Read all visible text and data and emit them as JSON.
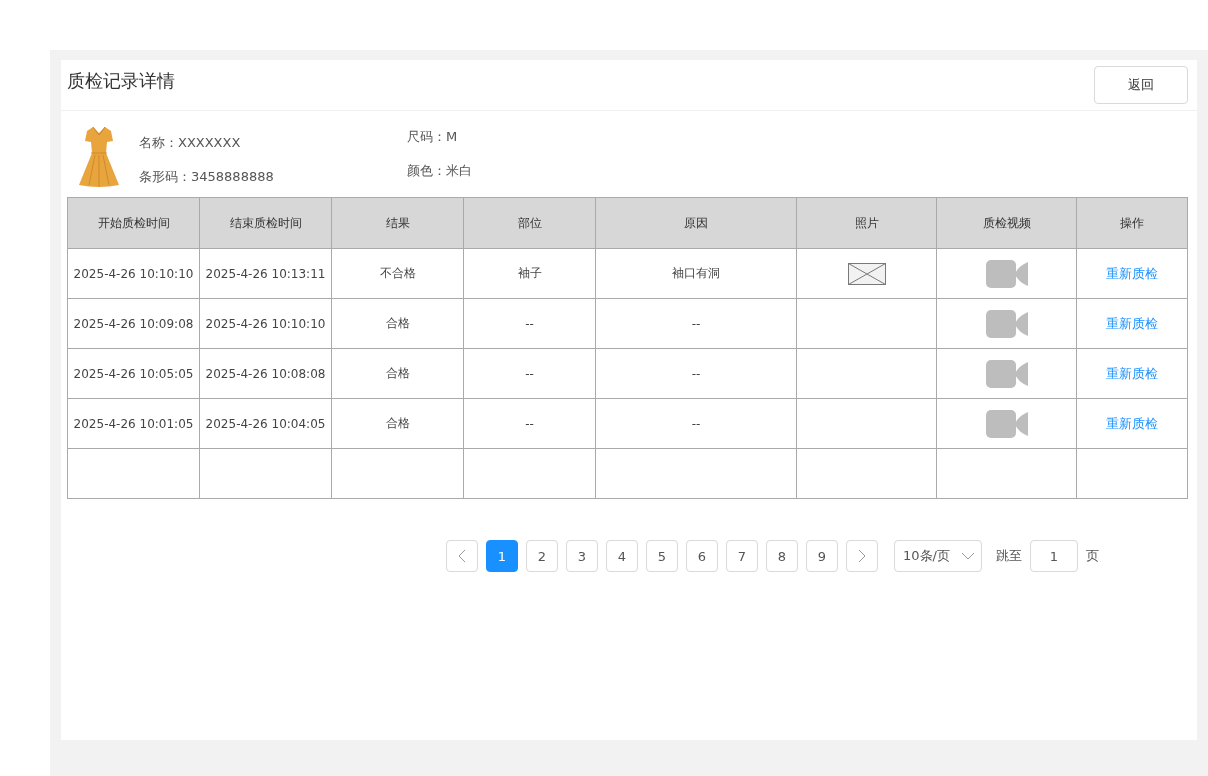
{
  "header": {
    "title": "质检记录详情",
    "back_button": "返回"
  },
  "product": {
    "name_label": "名称：",
    "name": "XXXXXXX",
    "barcode_label": "条形码：",
    "barcode": "3458888888",
    "size_label": "尺码：",
    "size": "M",
    "shade_label": "颜色：",
    "shade": "米白"
  },
  "table": {
    "columns": [
      "开始质检时间",
      "结束质检时间",
      "结果",
      "部位",
      "原因",
      "照片",
      "质检视频",
      "操作"
    ],
    "rows": [
      {
        "kind": "record",
        "start": "2025-4-26 10:10:10",
        "end": "2025-4-26 10:13:11",
        "result": "不合格",
        "part": "袖子",
        "reason": "袖口有洞",
        "has_photo": true,
        "has_video": true,
        "action": "重新质检"
      },
      {
        "kind": "record",
        "start": "2025-4-26 10:09:08",
        "end": "2025-4-26 10:10:10",
        "result": "合格",
        "part": "--",
        "reason": "--",
        "has_photo": false,
        "has_video": true,
        "action": "重新质检"
      },
      {
        "kind": "record",
        "start": "2025-4-26 10:05:05",
        "end": "2025-4-26 10:08:08",
        "result": "合格",
        "part": "--",
        "reason": "--",
        "has_photo": false,
        "has_video": true,
        "action": "重新质检"
      },
      {
        "kind": "record",
        "start": "2025-4-26 10:01:05",
        "end": "2025-4-26 10:04:05",
        "result": "合格",
        "part": "--",
        "reason": "--",
        "has_photo": false,
        "has_video": true,
        "action": "重新质检"
      },
      {
        "kind": "blank"
      }
    ]
  },
  "pagination": {
    "pages": [
      {
        "label": "1",
        "selected": true
      },
      {
        "label": "2",
        "selected": false
      },
      {
        "label": "3",
        "selected": false
      },
      {
        "label": "4",
        "selected": false
      },
      {
        "label": "5",
        "selected": false
      },
      {
        "label": "6",
        "selected": false
      },
      {
        "label": "7",
        "selected": false
      },
      {
        "label": "8",
        "selected": false
      },
      {
        "label": "9",
        "selected": false
      }
    ],
    "page_size": "10条/页",
    "jump_label": "跳至",
    "jump_value": "1",
    "page_unit": "页"
  }
}
